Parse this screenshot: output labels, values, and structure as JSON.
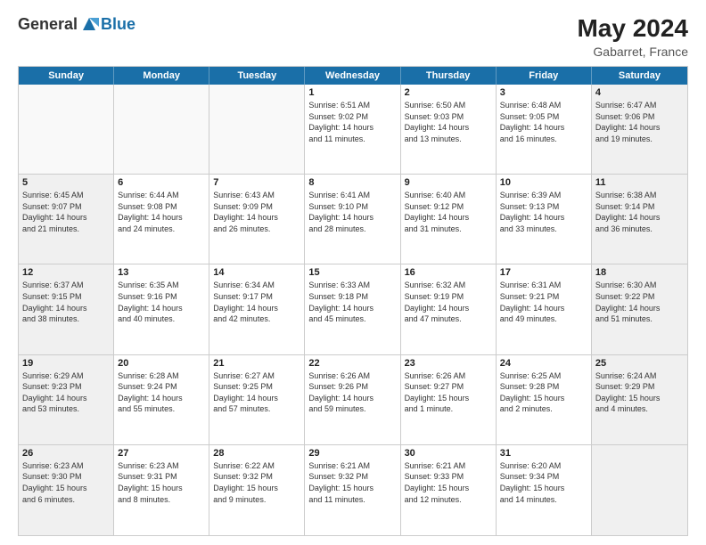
{
  "logo": {
    "general": "General",
    "blue": "Blue"
  },
  "header": {
    "month_year": "May 2024",
    "location": "Gabarret, France"
  },
  "days_of_week": [
    "Sunday",
    "Monday",
    "Tuesday",
    "Wednesday",
    "Thursday",
    "Friday",
    "Saturday"
  ],
  "weeks": [
    [
      {
        "day": "",
        "info": "",
        "empty": true
      },
      {
        "day": "",
        "info": "",
        "empty": true
      },
      {
        "day": "",
        "info": "",
        "empty": true
      },
      {
        "day": "1",
        "info": "Sunrise: 6:51 AM\nSunset: 9:02 PM\nDaylight: 14 hours\nand 11 minutes."
      },
      {
        "day": "2",
        "info": "Sunrise: 6:50 AM\nSunset: 9:03 PM\nDaylight: 14 hours\nand 13 minutes."
      },
      {
        "day": "3",
        "info": "Sunrise: 6:48 AM\nSunset: 9:05 PM\nDaylight: 14 hours\nand 16 minutes."
      },
      {
        "day": "4",
        "info": "Sunrise: 6:47 AM\nSunset: 9:06 PM\nDaylight: 14 hours\nand 19 minutes.",
        "shaded": true
      }
    ],
    [
      {
        "day": "5",
        "info": "Sunrise: 6:45 AM\nSunset: 9:07 PM\nDaylight: 14 hours\nand 21 minutes.",
        "shaded": true
      },
      {
        "day": "6",
        "info": "Sunrise: 6:44 AM\nSunset: 9:08 PM\nDaylight: 14 hours\nand 24 minutes."
      },
      {
        "day": "7",
        "info": "Sunrise: 6:43 AM\nSunset: 9:09 PM\nDaylight: 14 hours\nand 26 minutes."
      },
      {
        "day": "8",
        "info": "Sunrise: 6:41 AM\nSunset: 9:10 PM\nDaylight: 14 hours\nand 28 minutes."
      },
      {
        "day": "9",
        "info": "Sunrise: 6:40 AM\nSunset: 9:12 PM\nDaylight: 14 hours\nand 31 minutes."
      },
      {
        "day": "10",
        "info": "Sunrise: 6:39 AM\nSunset: 9:13 PM\nDaylight: 14 hours\nand 33 minutes."
      },
      {
        "day": "11",
        "info": "Sunrise: 6:38 AM\nSunset: 9:14 PM\nDaylight: 14 hours\nand 36 minutes.",
        "shaded": true
      }
    ],
    [
      {
        "day": "12",
        "info": "Sunrise: 6:37 AM\nSunset: 9:15 PM\nDaylight: 14 hours\nand 38 minutes.",
        "shaded": true
      },
      {
        "day": "13",
        "info": "Sunrise: 6:35 AM\nSunset: 9:16 PM\nDaylight: 14 hours\nand 40 minutes."
      },
      {
        "day": "14",
        "info": "Sunrise: 6:34 AM\nSunset: 9:17 PM\nDaylight: 14 hours\nand 42 minutes."
      },
      {
        "day": "15",
        "info": "Sunrise: 6:33 AM\nSunset: 9:18 PM\nDaylight: 14 hours\nand 45 minutes."
      },
      {
        "day": "16",
        "info": "Sunrise: 6:32 AM\nSunset: 9:19 PM\nDaylight: 14 hours\nand 47 minutes."
      },
      {
        "day": "17",
        "info": "Sunrise: 6:31 AM\nSunset: 9:21 PM\nDaylight: 14 hours\nand 49 minutes."
      },
      {
        "day": "18",
        "info": "Sunrise: 6:30 AM\nSunset: 9:22 PM\nDaylight: 14 hours\nand 51 minutes.",
        "shaded": true
      }
    ],
    [
      {
        "day": "19",
        "info": "Sunrise: 6:29 AM\nSunset: 9:23 PM\nDaylight: 14 hours\nand 53 minutes.",
        "shaded": true
      },
      {
        "day": "20",
        "info": "Sunrise: 6:28 AM\nSunset: 9:24 PM\nDaylight: 14 hours\nand 55 minutes."
      },
      {
        "day": "21",
        "info": "Sunrise: 6:27 AM\nSunset: 9:25 PM\nDaylight: 14 hours\nand 57 minutes."
      },
      {
        "day": "22",
        "info": "Sunrise: 6:26 AM\nSunset: 9:26 PM\nDaylight: 14 hours\nand 59 minutes."
      },
      {
        "day": "23",
        "info": "Sunrise: 6:26 AM\nSunset: 9:27 PM\nDaylight: 15 hours\nand 1 minute."
      },
      {
        "day": "24",
        "info": "Sunrise: 6:25 AM\nSunset: 9:28 PM\nDaylight: 15 hours\nand 2 minutes."
      },
      {
        "day": "25",
        "info": "Sunrise: 6:24 AM\nSunset: 9:29 PM\nDaylight: 15 hours\nand 4 minutes.",
        "shaded": true
      }
    ],
    [
      {
        "day": "26",
        "info": "Sunrise: 6:23 AM\nSunset: 9:30 PM\nDaylight: 15 hours\nand 6 minutes.",
        "shaded": true
      },
      {
        "day": "27",
        "info": "Sunrise: 6:23 AM\nSunset: 9:31 PM\nDaylight: 15 hours\nand 8 minutes."
      },
      {
        "day": "28",
        "info": "Sunrise: 6:22 AM\nSunset: 9:32 PM\nDaylight: 15 hours\nand 9 minutes."
      },
      {
        "day": "29",
        "info": "Sunrise: 6:21 AM\nSunset: 9:32 PM\nDaylight: 15 hours\nand 11 minutes."
      },
      {
        "day": "30",
        "info": "Sunrise: 6:21 AM\nSunset: 9:33 PM\nDaylight: 15 hours\nand 12 minutes."
      },
      {
        "day": "31",
        "info": "Sunrise: 6:20 AM\nSunset: 9:34 PM\nDaylight: 15 hours\nand 14 minutes."
      },
      {
        "day": "",
        "info": "",
        "empty": true,
        "shaded": true
      }
    ]
  ]
}
